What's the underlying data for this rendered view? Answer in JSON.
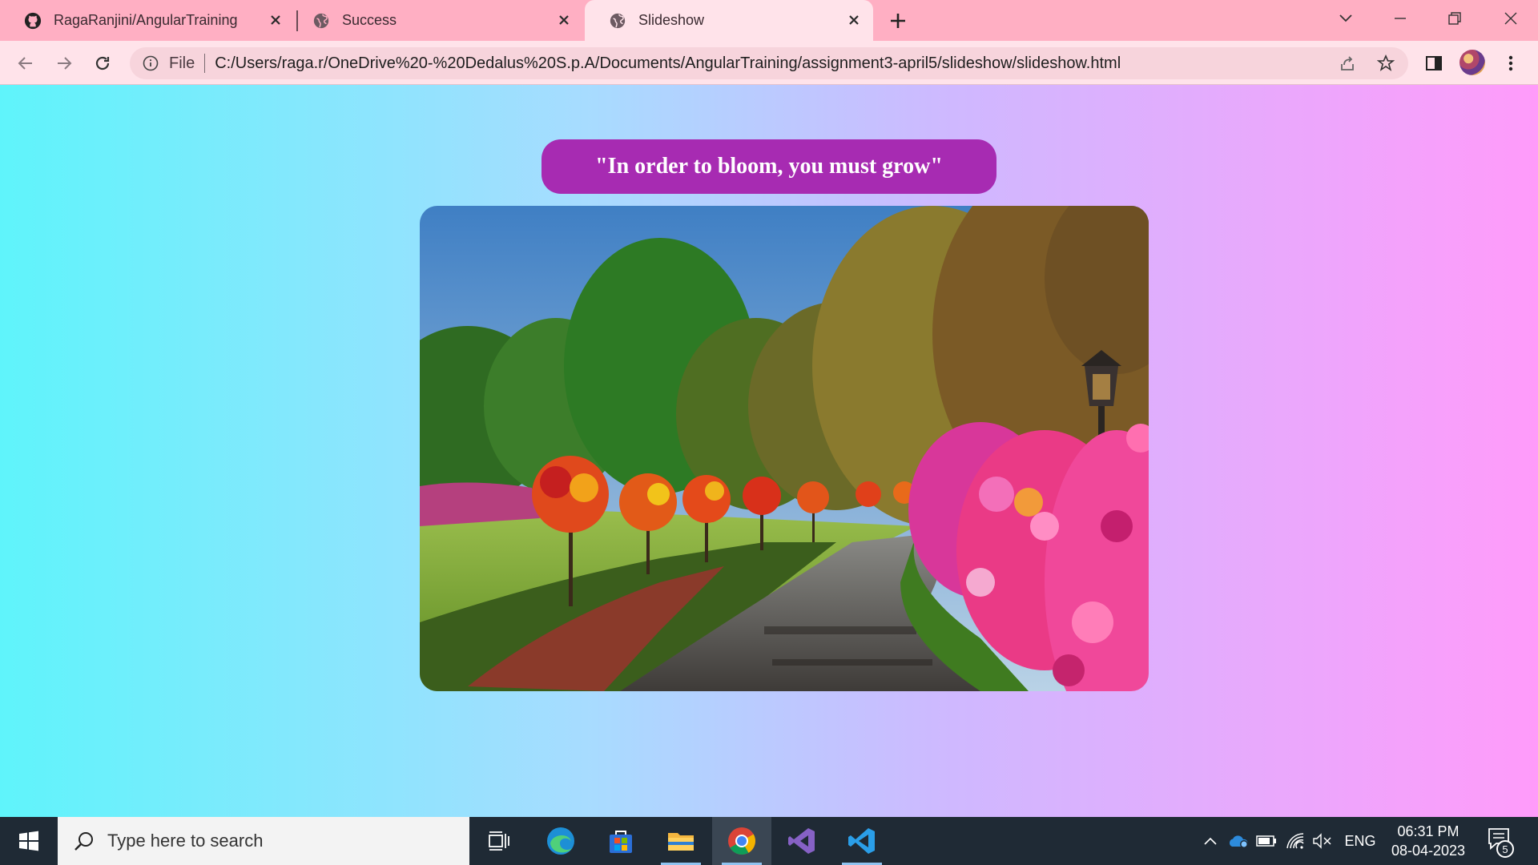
{
  "browser": {
    "tabs": [
      {
        "title": "RagaRanjini/AngularTraining",
        "icon": "github-icon",
        "active": false
      },
      {
        "title": "Success",
        "icon": "globe-icon",
        "active": false
      },
      {
        "title": "Slideshow",
        "icon": "globe-icon",
        "active": true
      }
    ],
    "address_bar": {
      "scheme_label": "File",
      "url": "C:/Users/raga.r/OneDrive%20-%20Dedalus%20S.p.A/Documents/AngularTraining/assignment3-april5/slideshow/slideshow.html"
    },
    "colors": {
      "tabstrip": "#ffafc3",
      "toolbar": "#ffe3ea"
    }
  },
  "page": {
    "quote": "\"In order to bloom, you must grow\"",
    "quote_bg": "#a72bb2",
    "slide_image": "garden path with flowering trees and lamp post",
    "gradient": [
      "#5ff4fb",
      "#a7dcff",
      "#cfb8ff",
      "#ff9bfa"
    ]
  },
  "taskbar": {
    "search_placeholder": "Type here to search",
    "apps": [
      "task-view",
      "edge",
      "microsoft-store",
      "file-explorer",
      "chrome",
      "visual-studio",
      "vs-code"
    ],
    "language": "ENG",
    "time": "06:31 PM",
    "date": "08-04-2023",
    "notification_count": "5"
  }
}
